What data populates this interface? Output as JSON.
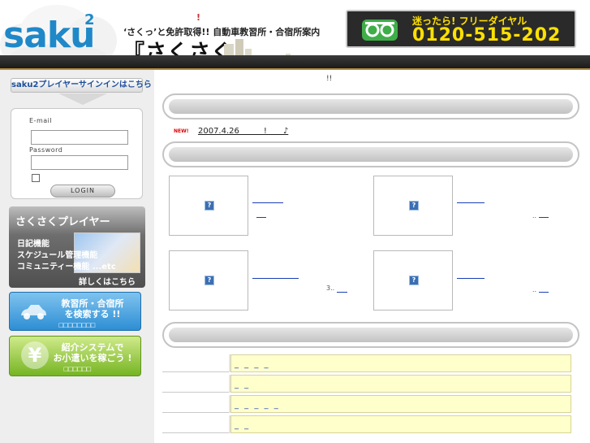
{
  "header": {
    "logo": "saku",
    "logo_sup": "2",
    "excl": "!",
    "tagline": "‘さくっ’と免許取得!! 自動車教習所・合宿所案内",
    "brand": "『さくさく』",
    "dial_label": "迷ったら! フリーダイヤル",
    "dial_number": "0120-515-202"
  },
  "sidebar": {
    "signin_tab": "saku2プレイヤーサインインはこちら",
    "login": {
      "email_label": "E-mail",
      "email_value": "",
      "password_label": "Password",
      "password_value": "",
      "login_button": "LOGIN"
    },
    "player": {
      "title": "さくさくプレイヤー",
      "features": [
        "日記機能",
        "スケジュール管理機能",
        "コミュニティー機能 ...etc"
      ],
      "more": "詳しくはこちら"
    },
    "search_banner": {
      "line1": "教習所・合宿所",
      "line2": "を検索する !!",
      "sub": "□□□□□□□□"
    },
    "referral_banner": {
      "yen": "¥",
      "line1": "紹介システムで",
      "line2": "お小遣いを稼ごう !",
      "sub": "□□□□□□"
    }
  },
  "main": {
    "notice": "!!",
    "news": {
      "badge": "NEW!",
      "text": "2007.4.26　　　!　　♪"
    },
    "cards": [
      {
        "icon": "?"
      },
      {
        "icon": "?"
      },
      {
        "icon": "?"
      },
      {
        "icon": "?"
      }
    ],
    "card_notes": [
      "..",
      "3..",
      ".."
    ],
    "info_rows": [
      {
        "value": "_ _ _ _"
      },
      {
        "value": "_ _"
      },
      {
        "value": "_ _ _ _ _"
      },
      {
        "value": "_ _"
      }
    ]
  },
  "colors": {
    "brand_blue": "#1f88c8",
    "dial_yellow": "#ffe000",
    "link_blue": "#1a3fb5",
    "info_yellow": "#ffffcc",
    "search_blue": "#2d8ed3",
    "referral_green": "#76b423"
  }
}
